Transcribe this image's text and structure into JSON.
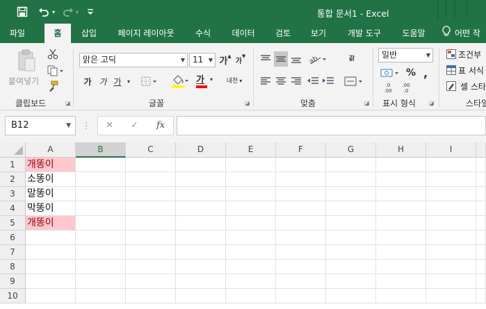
{
  "title_bar": {
    "title": "통합 문서1  -  Excel",
    "save_icon": "save-icon",
    "undo_icon": "undo-icon",
    "redo_icon": "redo-icon",
    "customize_icon": "customize-quick-access-icon"
  },
  "tabs": [
    {
      "label": "파일",
      "active": false
    },
    {
      "label": "홈",
      "active": true
    },
    {
      "label": "삽입",
      "active": false
    },
    {
      "label": "페이지 레이아웃",
      "active": false
    },
    {
      "label": "수식",
      "active": false
    },
    {
      "label": "데이터",
      "active": false
    },
    {
      "label": "검토",
      "active": false
    },
    {
      "label": "보기",
      "active": false
    },
    {
      "label": "개발 도구",
      "active": false
    },
    {
      "label": "도움말",
      "active": false
    }
  ],
  "tell_me": {
    "label": "어떤 작",
    "icon": "lightbulb-icon"
  },
  "ribbon": {
    "clipboard": {
      "paste_label": "붙여넣기",
      "group_label": "클립보드"
    },
    "font": {
      "font_name": "맑은 고딕",
      "font_size": "11",
      "grow_label": "가",
      "shrink_label": "가",
      "bold_label": "가",
      "italic_label": "가",
      "underline_label": "가",
      "font_color_label": "가",
      "phonetic_label": "내천",
      "group_label": "글꼴"
    },
    "alignment": {
      "wrap_label": "갉",
      "group_label": "맞춤"
    },
    "number": {
      "format": "일반",
      "percent": "%",
      "comma": ",",
      "inc_decimal": ".00",
      "dec_decimal": ".0",
      "group_label": "표시 형식"
    },
    "styles": {
      "conditional_label": "조건부",
      "table_label": "표 서식",
      "cell_style_label": "셀 스타",
      "group_label": "스타일"
    }
  },
  "formula_bar": {
    "name_box": "B12",
    "fx_label": "fx",
    "cancel_symbol": "✕",
    "enter_symbol": "✓",
    "formula": ""
  },
  "sheet": {
    "columns": [
      "A",
      "B",
      "C",
      "D",
      "E",
      "F",
      "G",
      "H",
      "I"
    ],
    "active_column": "B",
    "rows": [
      "1",
      "2",
      "3",
      "4",
      "5",
      "6",
      "7",
      "8",
      "9",
      "10"
    ],
    "cells": [
      {
        "ref": "A1",
        "value": "개똥이",
        "duplicate": true
      },
      {
        "ref": "A2",
        "value": "소똥이",
        "duplicate": false
      },
      {
        "ref": "A3",
        "value": "말똥이",
        "duplicate": false
      },
      {
        "ref": "A4",
        "value": "막똥이",
        "duplicate": false
      },
      {
        "ref": "A5",
        "value": "개똥이",
        "duplicate": true
      }
    ],
    "colors": {
      "duplicate_fill": "#ffc7ce",
      "duplicate_text": "#9c0006",
      "accent": "#217346"
    }
  }
}
